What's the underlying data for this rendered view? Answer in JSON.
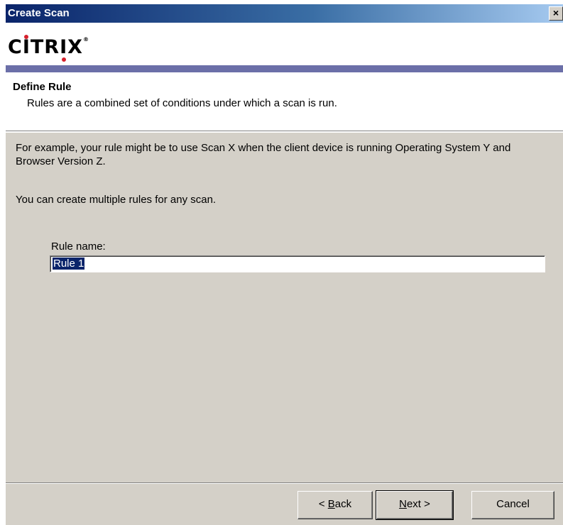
{
  "window": {
    "title": "Create Scan",
    "close_label": "×"
  },
  "brand": {
    "logo_prefix": "C",
    "logo_i1": "I",
    "logo_mid": "TR",
    "logo_i2": "I",
    "logo_suffix": "X",
    "logo_tm": "®",
    "accent_color": "#d6202c",
    "bar_color": "#6b6fa8"
  },
  "header": {
    "title": "Define Rule",
    "subtitle": "Rules are a combined set of conditions under which a scan is run."
  },
  "body": {
    "paragraph1": "For example, your rule might be to use Scan X when the client device is running Operating System Y and Browser Version Z.",
    "paragraph2": "You can create multiple rules for any scan.",
    "rule_name_label": "Rule name:",
    "rule_name_value": "Rule 1"
  },
  "buttons": {
    "back_prefix": "< ",
    "back_mnemonic": "B",
    "back_rest": "ack",
    "next_mnemonic": "N",
    "next_rest": "ext >",
    "cancel": "Cancel"
  }
}
